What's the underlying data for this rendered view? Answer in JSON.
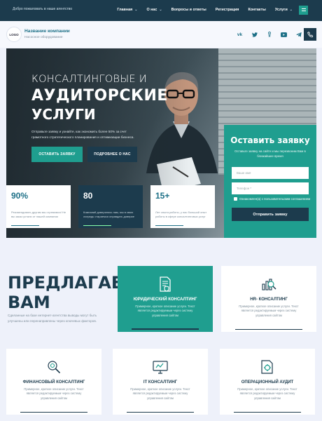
{
  "topbar": {
    "welcome": "Добро пожаловать в наше агентство",
    "nav": [
      "Главная",
      "О нас",
      "Вопросы и ответы",
      "Регистрация",
      "Контакты",
      "Услуги"
    ]
  },
  "header": {
    "logo": "LOGO",
    "company_name": "Название компании",
    "company_sub": "Насосное оборудование",
    "socials": [
      "vk-icon",
      "twitter-icon",
      "odnoklassniki-icon",
      "youtube-icon",
      "telegram-icon"
    ]
  },
  "hero": {
    "title_line1": "КОНСАЛТИНГОВЫЕ И",
    "title_line2": "АУДИТОРСКИЕ",
    "title_line3": "УСЛУГИ",
    "description": "Отправьте заявку и узнайте, как экономить более 50% за счет грамотного стратегического планирования и оптимизации бизнеса.",
    "btn_primary": "ОСТАВИТЬ ЗАЯВКУ",
    "btn_secondary": "ПОДРОБНЕЕ О НАС"
  },
  "form": {
    "title": "Оставить заявку",
    "subtitle": "Оставьте заявку на сайте и мы перезвоним Вам в ближайшее время",
    "name_placeholder": "Ваше имя",
    "phone_placeholder": "Телефон *",
    "consent": "Ознакомлен(а) с пользовательским соглашением",
    "submit": "Отправить заявку"
  },
  "stats": [
    {
      "num": "90%",
      "text": "Рекомендовать другим мы стремимся! Не вы заказ устали от нашей компании"
    },
    {
      "num": "80",
      "text": "Компаний доверились нам, мы в свою очередь стараемся оправдать доверие"
    },
    {
      "num": "15+",
      "text": "Лет опыта работы, у нас большой опыт работы в сфере консалтинговых услуг"
    }
  ],
  "offer": {
    "title_line1": "ПРЕДЛАГАЕМ",
    "title_line2": "ВАМ",
    "description": "Сделанные на базе интернет-агентства выводы могут быть улучшены или перенаправлены через ключевых факторов."
  },
  "services": [
    {
      "title": "ЮРИДИЧЕСКИЙ КОНСАЛТИНГ",
      "desc": "Примерное, краткое описание услуги. Текст является редактируемым через систему управления сайтом",
      "icon": "legal-document-icon"
    },
    {
      "title": "HR- КОНСАЛТИНГ",
      "desc": "Примерное, краткое описание услуги. Текст является редактируемым через систему управления сайтом",
      "icon": "hr-chart-icon"
    },
    {
      "title": "ФИНАНСОВЫЙ КОНСАЛТИНГ",
      "desc": "Примерное, краткое описание услуги. Текст является редактируемым через систему управления сайтом",
      "icon": "finance-search-icon"
    },
    {
      "title": "IT КОНСАЛТИНГ",
      "desc": "Примерное, краткое описание услуги. Текст является редактируемым через систему управления сайтом",
      "icon": "it-monitor-icon"
    },
    {
      "title": "ОПЕРАЦИОННЫЙ АУДИТ",
      "desc": "Примерное, краткое описание услуги. Текст является редактируемым через систему управления сайтом",
      "icon": "operations-gear-icon"
    }
  ]
}
